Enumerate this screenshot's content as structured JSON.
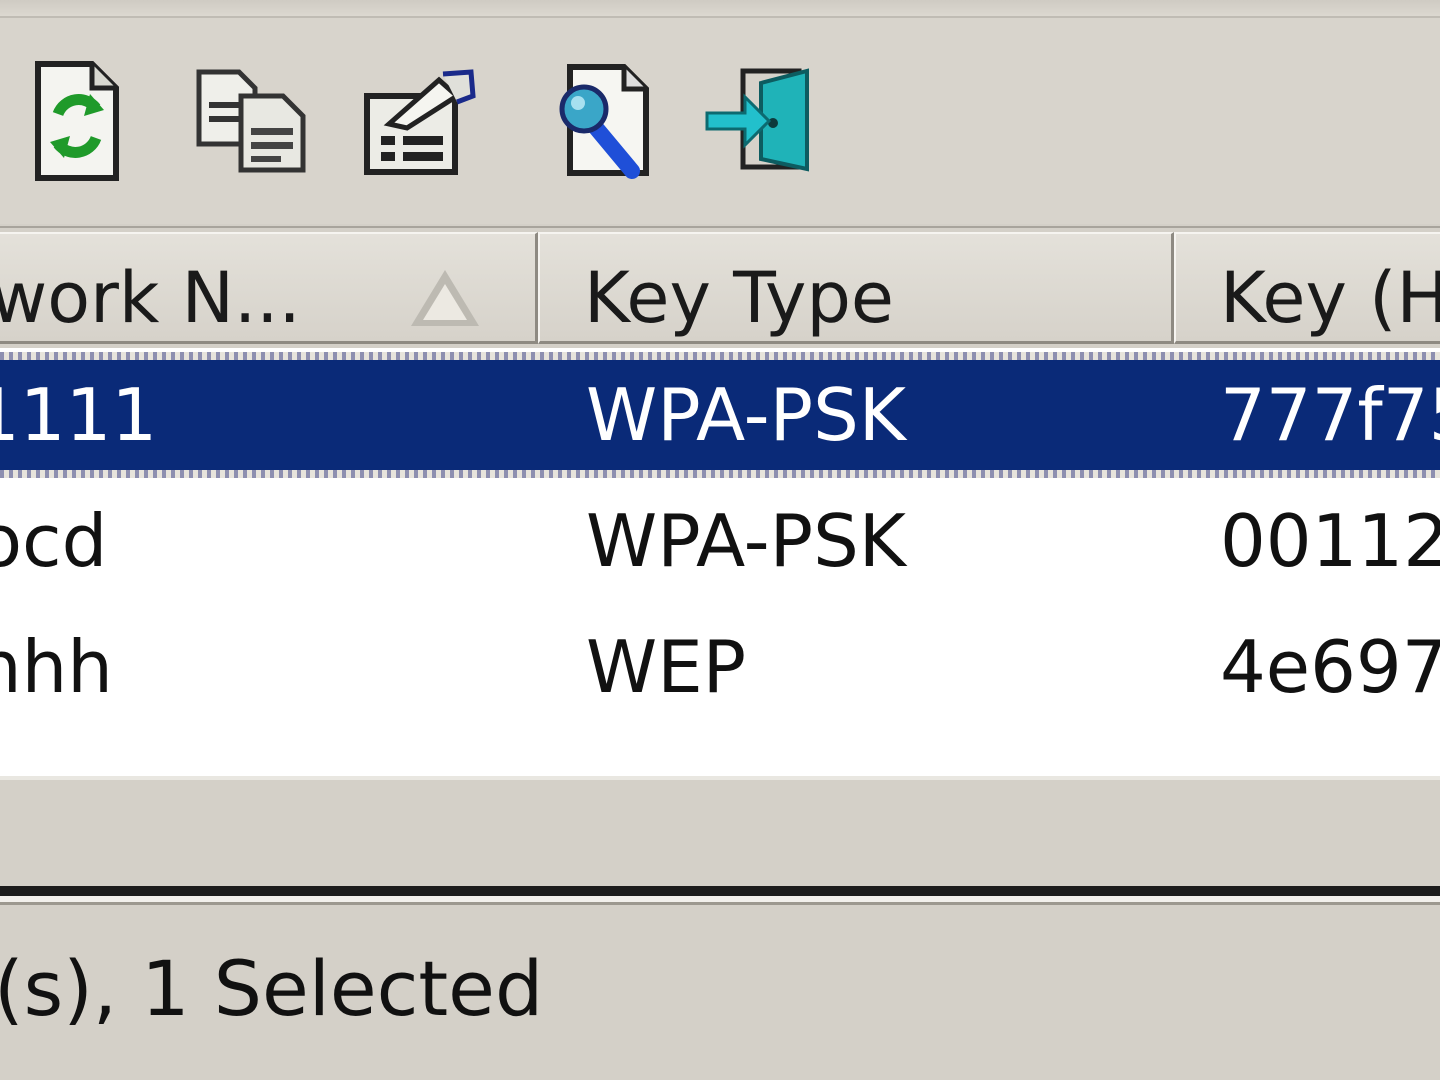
{
  "toolbar": {
    "buttons": [
      {
        "icon": "refresh-document-icon"
      },
      {
        "icon": "copy-documents-icon"
      },
      {
        "icon": "properties-document-icon"
      },
      {
        "icon": "find-document-icon"
      },
      {
        "icon": "exit-door-icon"
      }
    ]
  },
  "list": {
    "columns": [
      "work N...",
      "Key Type",
      "Key (H"
    ],
    "sorted_column": 0,
    "rows": [
      {
        "name": "1111",
        "key_type": "WPA-PSK",
        "key": "777f75",
        "selected": true
      },
      {
        "name": "ocd",
        "key_type": "WPA-PSK",
        "key": "00112",
        "selected": false
      },
      {
        "name": "hhh",
        "key_type": "WEP",
        "key": "4e697",
        "selected": false
      }
    ]
  },
  "status": {
    "text": "(s), 1 Selected"
  },
  "colors": {
    "selection": "#0a2a78",
    "window_bg": "#d4d0c8",
    "list_bg": "#ffffff"
  }
}
